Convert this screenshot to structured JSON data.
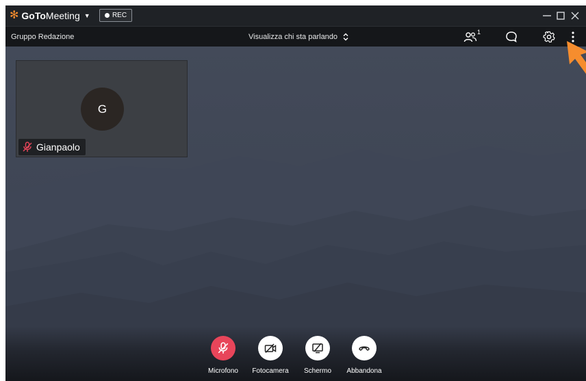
{
  "app": {
    "brand_bold": "GoTo",
    "brand_regular": "Meeting",
    "rec_label": "REC"
  },
  "toolbar": {
    "group_name": "Gruppo Redazione",
    "view_label": "Visualizza chi sta parlando",
    "participants_count": "1"
  },
  "participant": {
    "initial": "G",
    "name": "Gianpaolo"
  },
  "controls": {
    "microphone": "Microfono",
    "camera": "Fotocamera",
    "screen": "Schermo",
    "leave": "Abbandona"
  },
  "colors": {
    "brand_orange": "#f68d2e",
    "mic_muted_red": "#e8455a",
    "stage_background": "#3e4554"
  },
  "icons": {
    "participants": "participants-icon",
    "chat": "chat-icon",
    "settings": "gear-icon",
    "more": "more-vertical-icon",
    "mic": "mic-off-icon",
    "camera": "camera-off-icon",
    "screen": "screen-share-off-icon",
    "leave": "hang-up-icon"
  }
}
